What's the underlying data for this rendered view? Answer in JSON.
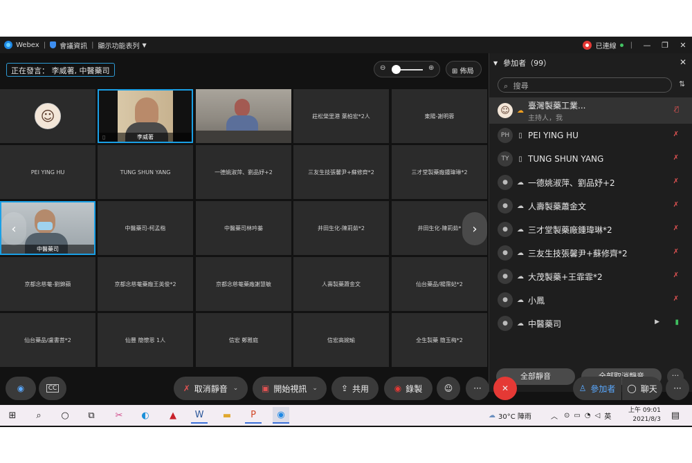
{
  "titlebar": {
    "app_name": "Webex",
    "meeting_info": "會議資訊",
    "show_menu": "顯示功能表列",
    "connection_status": "已連線",
    "minimize": "—",
    "restore": "❐",
    "close": "✕"
  },
  "speaking": {
    "label": "正在發言： 李威著, 中醫藥司"
  },
  "layout_button": "佈局",
  "tiles": [
    {
      "label": ""
    },
    {
      "label": "李威著"
    },
    {
      "label": ""
    },
    {
      "label": "莊松榮里港 葉柏宏*2人"
    },
    {
      "label": "東陽-謝明蓉"
    },
    {
      "label": "PEI YING HU"
    },
    {
      "label": "TUNG SHUN YANG"
    },
    {
      "label": "一德姚淑萍、劉品妤+2"
    },
    {
      "label": "三友生技張馨尹+蘇修齊*2"
    },
    {
      "label": "三才堂製藥廠鍾瑋琳*2"
    },
    {
      "label": "中醫藥司"
    },
    {
      "label": "中醫藥司-柯孟楷"
    },
    {
      "label": "中醫藥司林吟蓁"
    },
    {
      "label": "井田生化-陳莉茹*2"
    },
    {
      "label": "井田生化-陳莉茹*"
    },
    {
      "label": "京都念慈菴-劉錦蘋"
    },
    {
      "label": "京都念慈菴藥廠王英俊*2"
    },
    {
      "label": "京都念慈菴藥廠謝慧敏"
    },
    {
      "label": "人壽製藥蕭金文"
    },
    {
      "label": "仙台藥品/楊霈妃*2"
    },
    {
      "label": "仙台藥品/盧書菩*2"
    },
    {
      "label": "仙豐 簡懷恩 1人"
    },
    {
      "label": "信宏 鄭雅庭"
    },
    {
      "label": "信宏高婉瑜"
    },
    {
      "label": "全生製藥 簡玉梅*2"
    }
  ],
  "participants_panel": {
    "title": "參加者（99）",
    "search_placeholder": "搜尋",
    "host_name": "臺灣製藥工業...",
    "host_sub": "主持人，我",
    "items": [
      {
        "avatar": "PH",
        "name": "PEI YING HU"
      },
      {
        "avatar": "TY",
        "name": "TUNG SHUN YANG"
      },
      {
        "avatar": "",
        "name": "一德姚淑萍、劉品妤+2"
      },
      {
        "avatar": "",
        "name": "人壽製藥蕭金文"
      },
      {
        "avatar": "",
        "name": "三才堂製藥廠鍾瑋琳*2"
      },
      {
        "avatar": "",
        "name": "三友生技張馨尹+蘇修齊*2"
      },
      {
        "avatar": "",
        "name": "大茂製藥+王霏霏*2"
      },
      {
        "avatar": "",
        "name": "小鳳"
      },
      {
        "avatar": "",
        "name": "中醫藥司"
      }
    ],
    "mute_all": "全部靜音",
    "unmute_all": "全部取消靜音"
  },
  "controls": {
    "unmute": "取消靜音",
    "start_video": "開始視訊",
    "share": "共用",
    "record": "錄製",
    "participants": "參加者",
    "chat": "聊天"
  },
  "taskbar": {
    "weather": "30°C 陣雨",
    "ime": "英",
    "time": "上午 09:01",
    "date": "2021/8/3"
  },
  "colors": {
    "accent": "#1aa0e6",
    "danger": "#e53935",
    "mic_on": "#3fbf5f"
  }
}
